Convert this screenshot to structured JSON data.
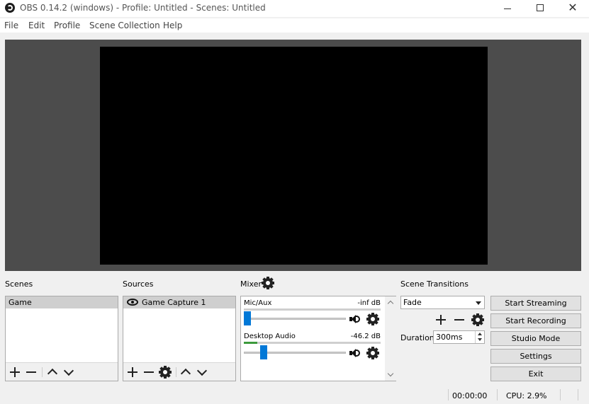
{
  "window": {
    "title": "OBS 0.14.2 (windows) - Profile: Untitled - Scenes: Untitled",
    "icon": "obs-logo-icon"
  },
  "menu": [
    "File",
    "Edit",
    "Profile",
    "Scene Collection",
    "Help"
  ],
  "scenes": {
    "title": "Scenes",
    "items": [
      "Game"
    ],
    "selected": "Game"
  },
  "sources": {
    "title": "Sources",
    "items": [
      "Game Capture 1"
    ]
  },
  "mixer": {
    "title": "Mixer",
    "channels": [
      {
        "name": "Mic/Aux",
        "db": "-inf dB",
        "meter_level": 0.0,
        "volume": 0.0
      },
      {
        "name": "Desktop Audio",
        "db": "-46.2 dB",
        "meter_level": 0.1,
        "volume": 0.17
      }
    ]
  },
  "transitions": {
    "title": "Scene Transitions",
    "selected": "Fade",
    "duration_label": "Duration",
    "duration_value": "300ms"
  },
  "controls": {
    "start_streaming": "Start Streaming",
    "start_recording": "Start Recording",
    "studio_mode": "Studio Mode",
    "settings": "Settings",
    "exit": "Exit"
  },
  "status": {
    "time": "00:00:00",
    "cpu": "CPU: 2.9%"
  },
  "colors": {
    "preview_bg": "#4c4c4c",
    "canvas": "#000000",
    "slider_accent": "#0078d7",
    "meter_green": "#3c9a3c"
  }
}
